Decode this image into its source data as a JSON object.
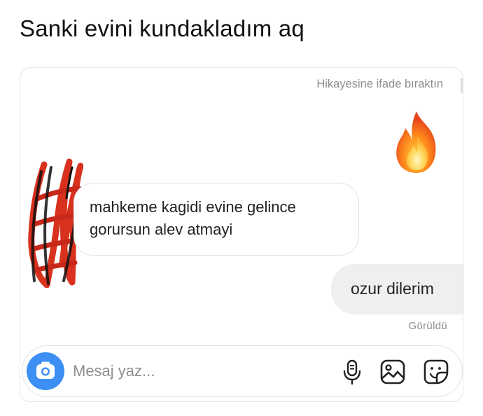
{
  "post": {
    "caption": "Sanki evini kundakladım aq"
  },
  "chat": {
    "reaction_note": "Hikayesine ifade bıraktın",
    "reaction_emoji": "fire-emoji",
    "messages": [
      {
        "direction": "incoming",
        "lines": [
          "mahkeme kagidi evine gelince",
          "gorursun alev atmayi"
        ]
      },
      {
        "direction": "outgoing",
        "text": "ozur dilerim"
      }
    ],
    "seen_status": "Görüldü",
    "avatar": "scribbled-out-avatar"
  },
  "composer": {
    "placeholder": "Mesaj yaz...",
    "value": "",
    "icons": [
      "camera-icon",
      "microphone-icon",
      "gallery-icon",
      "sticker-icon"
    ]
  },
  "colors": {
    "camera_button": "#3d8ff3",
    "outgoing_bubble": "#efefef",
    "meta_text": "#8e8e8e",
    "scribble_red": "#d8321e",
    "scribble_black": "#111111"
  }
}
